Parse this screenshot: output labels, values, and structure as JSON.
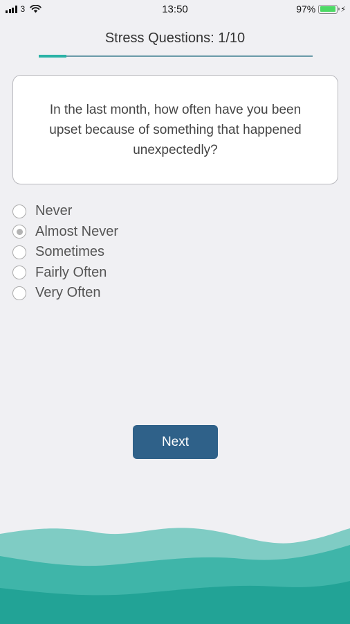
{
  "status_bar": {
    "carrier": "3",
    "time": "13:50",
    "battery_percent": "97%",
    "battery_level": 0.97,
    "icons": [
      "signal-icon",
      "wifi-icon",
      "battery-icon",
      "charging-icon"
    ]
  },
  "header": {
    "title": "Stress Questions: 1/10",
    "progress": {
      "current": 1,
      "total": 10
    }
  },
  "question": {
    "text": "In the last month, how often have you been upset because of something that happened unexpectedly?"
  },
  "options": [
    {
      "label": "Never",
      "selected": false
    },
    {
      "label": "Almost Never",
      "selected": true
    },
    {
      "label": "Sometimes",
      "selected": false
    },
    {
      "label": "Fairly Often",
      "selected": false
    },
    {
      "label": "Very Often",
      "selected": false
    }
  ],
  "next_button": {
    "label": "Next"
  },
  "colors": {
    "background": "#f0f0f3",
    "accent": "#2ab2a6",
    "button": "#2f6189",
    "wave_light": "#7fccc4",
    "wave_mid": "#3fb5a9",
    "wave_dark": "#22a396"
  }
}
